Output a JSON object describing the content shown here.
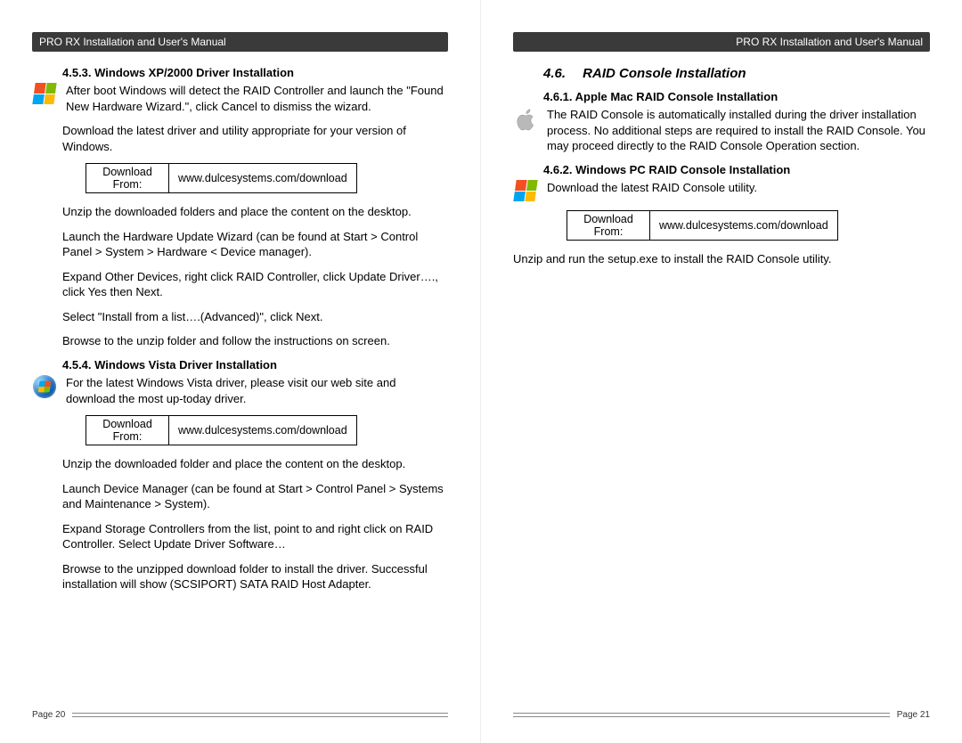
{
  "doc_title": "PRO RX Installation and User's Manual",
  "left": {
    "s453": {
      "heading": "4.5.3. Windows XP/2000 Driver Installation",
      "p1": "After boot Windows will detect the RAID Controller and launch the \"Found New Hardware Wizard.\", click Cancel to dismiss the wizard.",
      "p2": "Download the latest driver and utility appropriate for your version of Windows.",
      "dl_label": "Download From:",
      "dl_url": "www.dulcesystems.com/download",
      "p3": "Unzip the downloaded folders and place the content on the desktop.",
      "p4": "Launch the Hardware Update Wizard (can be found at Start > Control Panel > System > Hardware < Device manager).",
      "p5": "Expand Other Devices, right click RAID Controller, click Update Driver…., click Yes then Next.",
      "p6": "Select \"Install from a list….(Advanced)\", click Next.",
      "p7": "Browse to the unzip folder and follow the instructions on screen."
    },
    "s454": {
      "heading": "4.5.4. Windows Vista Driver Installation",
      "p1": "For the latest Windows Vista driver, please visit our web site and download the most up-today driver.",
      "dl_label": "Download From:",
      "dl_url": "www.dulcesystems.com/download",
      "p2": "Unzip the downloaded folder and place the content on the desktop.",
      "p3": "Launch Device Manager (can be found at Start > Control Panel > Systems and Maintenance > System).",
      "p4": "Expand Storage Controllers from the list, point to and right click on RAID Controller.   Select Update Driver Software…",
      "p5": "Browse to the unzipped download folder to install the driver.  Successful installation will show (SCSIPORT) SATA RAID Host Adapter."
    },
    "page_label": "Page 20"
  },
  "right": {
    "s46": {
      "num": "4.6.",
      "title": "RAID Console Installation"
    },
    "s461": {
      "heading": "4.6.1. Apple Mac RAID Console Installation",
      "p1": "The RAID Console is automatically installed during the driver installation process.  No additional steps are required to install the RAID Console. You may proceed directly to the RAID Console Operation section."
    },
    "s462": {
      "heading": "4.6.2. Windows PC RAID Console Installation",
      "p1": "Download the latest RAID Console utility.",
      "dl_label": "Download From:",
      "dl_url": "www.dulcesystems.com/download",
      "p2": "Unzip and run the setup.exe to install the RAID Console utility."
    },
    "page_label": "Page 21"
  }
}
